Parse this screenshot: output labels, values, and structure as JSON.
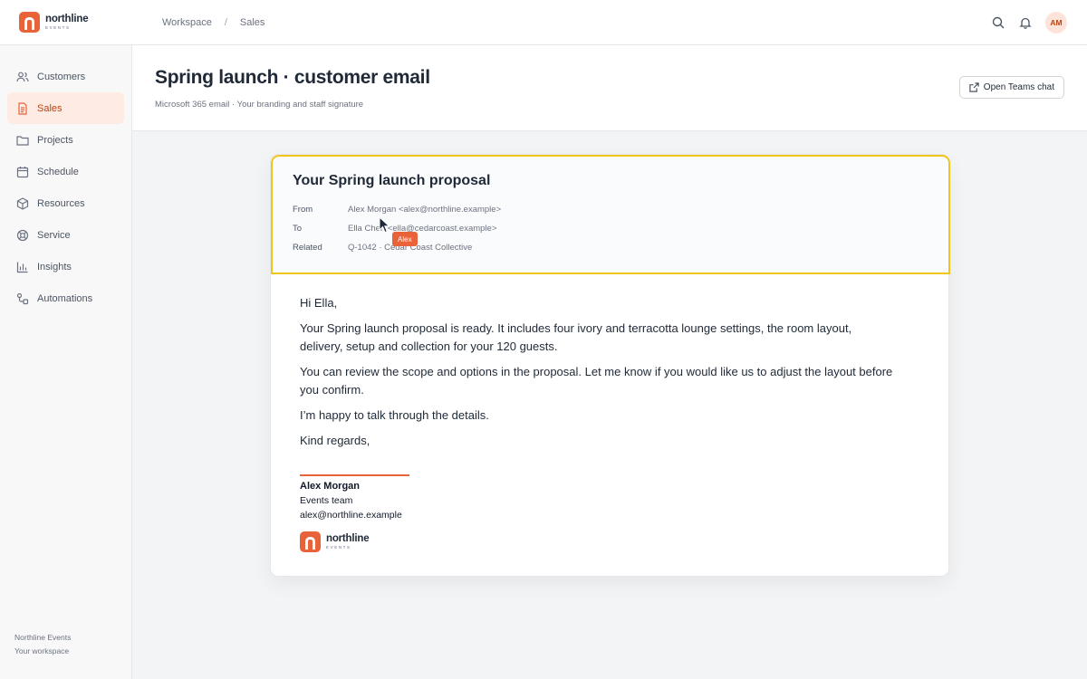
{
  "brand": {
    "name": "northline",
    "sub": "EVENTS"
  },
  "breadcrumb": {
    "items": [
      "Workspace",
      "Sales"
    ],
    "separator": "/"
  },
  "topbar": {
    "avatar_initials": "AM"
  },
  "sidebar": {
    "items": [
      {
        "label": "Customers",
        "icon": "users-icon"
      },
      {
        "label": "Sales",
        "icon": "document-icon",
        "active": true
      },
      {
        "label": "Projects",
        "icon": "folder-icon"
      },
      {
        "label": "Schedule",
        "icon": "calendar-icon"
      },
      {
        "label": "Resources",
        "icon": "box-icon"
      },
      {
        "label": "Service",
        "icon": "lifebuoy-icon"
      },
      {
        "label": "Insights",
        "icon": "bar-chart-icon"
      },
      {
        "label": "Automations",
        "icon": "workflow-icon"
      }
    ],
    "footer": {
      "org": "Northline Events",
      "workspace": "Your workspace"
    }
  },
  "page": {
    "title": "Spring launch · customer email",
    "subtitle": "Microsoft 365 email · Your branding and staff signature",
    "teams_button": "Open Teams chat"
  },
  "email": {
    "subject": "Your Spring launch proposal",
    "from_label": "From",
    "from": "Alex Morgan <alex@northline.example>",
    "to_label": "To",
    "to": "Ella Chen <ella@cedarcoast.example>",
    "related_label": "Related",
    "related": "Q-1042 · Cedar Coast Collective",
    "body": [
      "Hi Ella,",
      "Your Spring launch proposal is ready. It includes four ivory and terracotta lounge settings, the room layout, delivery, setup and collection for your 120 guests.",
      "You can review the scope and options in the proposal. Let me know if you would like us to adjust the layout before you confirm.",
      "I’m happy to talk through the details.",
      "Kind regards,"
    ],
    "signature": {
      "name": "Alex Morgan",
      "team": "Events team",
      "email": "alex@northline.example"
    }
  },
  "cursor": {
    "label": "Alex"
  },
  "colors": {
    "accent": "#e8623a",
    "highlight": "#f2c51c"
  }
}
